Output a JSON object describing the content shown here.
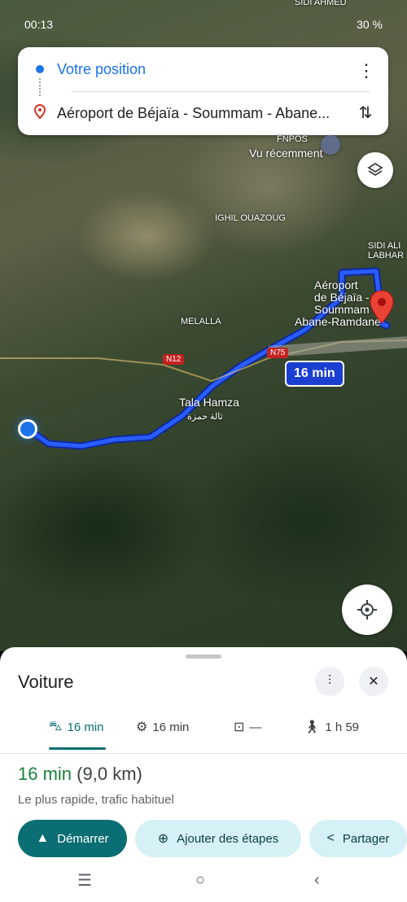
{
  "status_bar": {
    "time": "00:13",
    "battery": "30 %"
  },
  "directions": {
    "origin": "Votre position",
    "destination": "Aéroport de Béjaïa - Soummam - Abane..."
  },
  "map": {
    "labels": {
      "sidi_ahmed": "SIDI AHMED",
      "fnpos": "FNPOS",
      "vu_recemment": "Vu récemment",
      "ighil_ouazoug": "IGHIL OUAZOUG",
      "sidi_ali_labhar": "SIDI ALI LABHAR",
      "airport_line1": "Aéroport",
      "airport_line2": "de Béjaïa -",
      "airport_line3": "Soummam -",
      "airport_line4": "Abane-Ramdane",
      "melalla": "MELALLA",
      "tala_hamza": "Tala Hamza",
      "tala_hamza_ar": "ثالة حمزة",
      "n12": "N12",
      "n75": "N75"
    },
    "route_duration": "16 min",
    "route_color": "#1a3fd1"
  },
  "sheet": {
    "title": "Voiture",
    "modes": [
      {
        "icon": "car-icon",
        "label": "16 min",
        "active": true
      },
      {
        "icon": "motorcycle-icon",
        "label": "16 min",
        "active": false
      },
      {
        "icon": "train-icon",
        "label": "—",
        "active": false
      },
      {
        "icon": "walk-icon",
        "label": "1 h 59",
        "active": false
      }
    ],
    "summary_time": "16 min",
    "summary_distance": "(9,0 km)",
    "subtitle": "Le plus rapide, trafic habituel",
    "start_label": "Démarrer",
    "add_stops_label": "Ajouter des étapes",
    "share_label": "Partager"
  },
  "colors": {
    "accent": "#0b6e74",
    "duration_green": "#188038",
    "route_blue": "#1a3fd1"
  }
}
